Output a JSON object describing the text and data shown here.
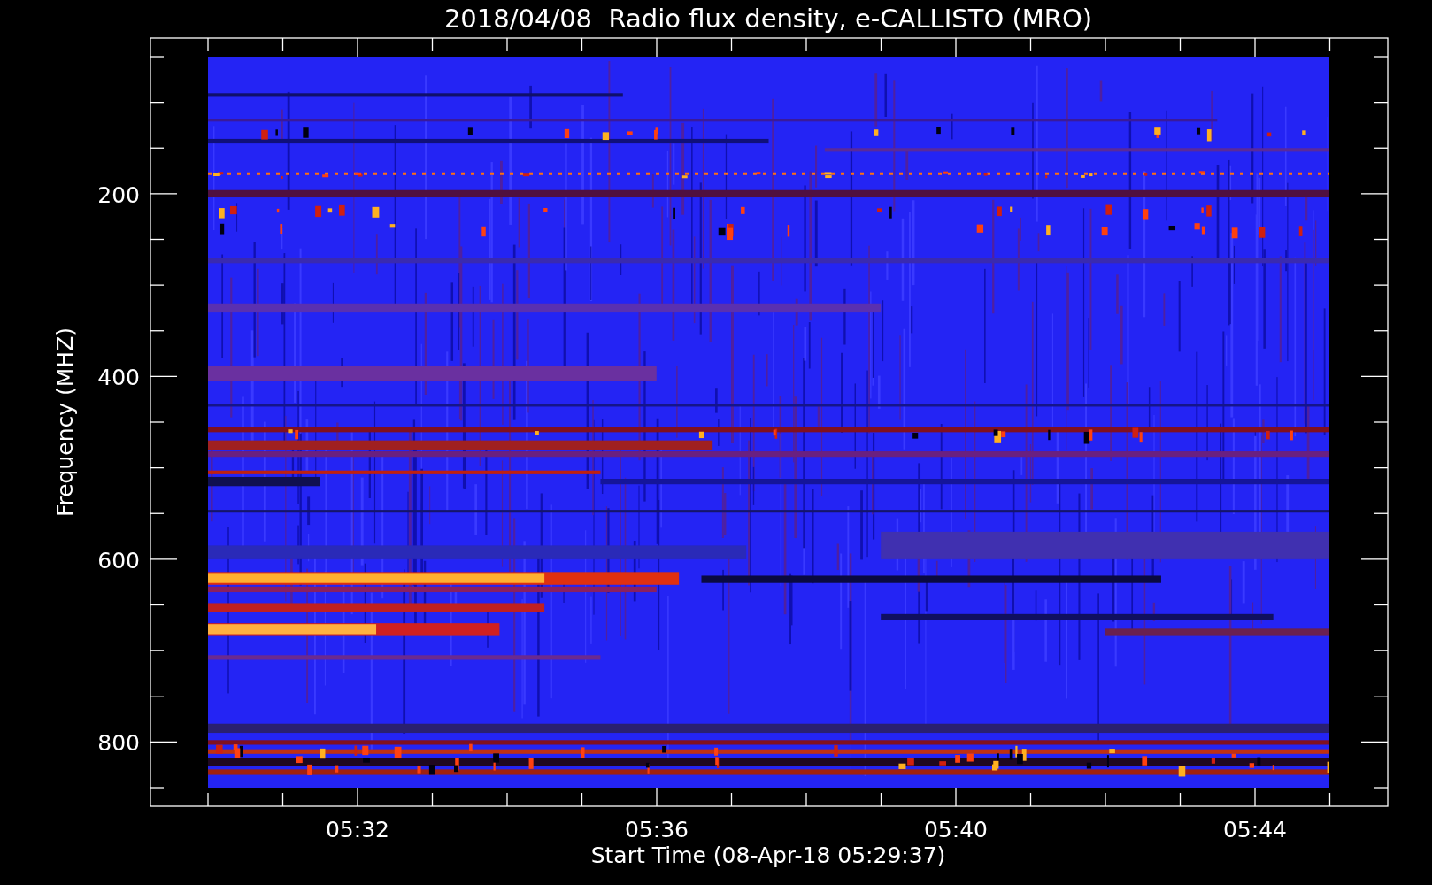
{
  "title": "2018/04/08  Radio flux density, e-CALLISTO (MRO)",
  "y_axis": {
    "label": "Frequency (MHZ)",
    "ticks": [
      "200",
      "400",
      "600",
      "800"
    ]
  },
  "x_axis": {
    "label": "Start Time (08-Apr-18 05:29:37)",
    "ticks": [
      "05:32",
      "05:36",
      "05:40",
      "05:44"
    ]
  }
}
